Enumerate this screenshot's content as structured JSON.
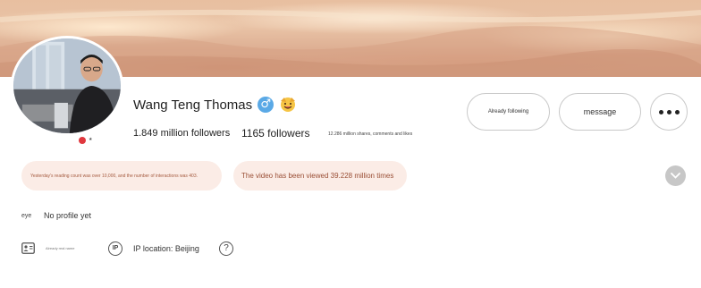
{
  "profile": {
    "name": "Wang Teng Thomas",
    "gender_icon": "male-icon",
    "badge_icon": "smiling-face-icon",
    "stats": {
      "likes_followers": "1.849 million followers",
      "followers": "1165 followers",
      "shares": "12.286 million shares, comments and likes"
    }
  },
  "actions": {
    "follow_label": "Already following",
    "message_label": "message",
    "more_icon": "more-icon"
  },
  "highlights": {
    "reading": "Yesterday's reading count was over 10,000, and the number of interactions was 403.",
    "views": "The video has been viewed 39.228 million times"
  },
  "details": {
    "eye_label": "eye",
    "profile_text": "No profile yet",
    "realname_text": "Already real name",
    "ip_icon_letter": "IP",
    "ip_location": "IP location: Beijing",
    "help_icon": "?"
  },
  "colors": {
    "banner": "#e5b898",
    "highlight_bg": "#fbece6",
    "highlight_text": "#9a4f36",
    "gender": "#5aa9e6"
  }
}
